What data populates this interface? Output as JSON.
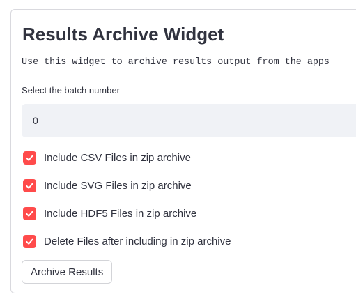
{
  "widget": {
    "title": "Results Archive Widget",
    "description": "Use this widget to archive results output from the apps"
  },
  "batch": {
    "label": "Select the batch number",
    "value": "0"
  },
  "options": [
    {
      "label": "Include CSV Files in zip archive",
      "checked": true
    },
    {
      "label": "Include SVG Files in zip archive",
      "checked": true
    },
    {
      "label": "Include HDF5 Files in zip archive",
      "checked": true
    },
    {
      "label": "Delete Files after including in zip archive",
      "checked": true
    }
  ],
  "actions": {
    "archive_label": "Archive Results"
  },
  "colors": {
    "checkbox_accent": "#ff4b4b",
    "input_background": "#f0f2f6",
    "text": "#31333f"
  }
}
